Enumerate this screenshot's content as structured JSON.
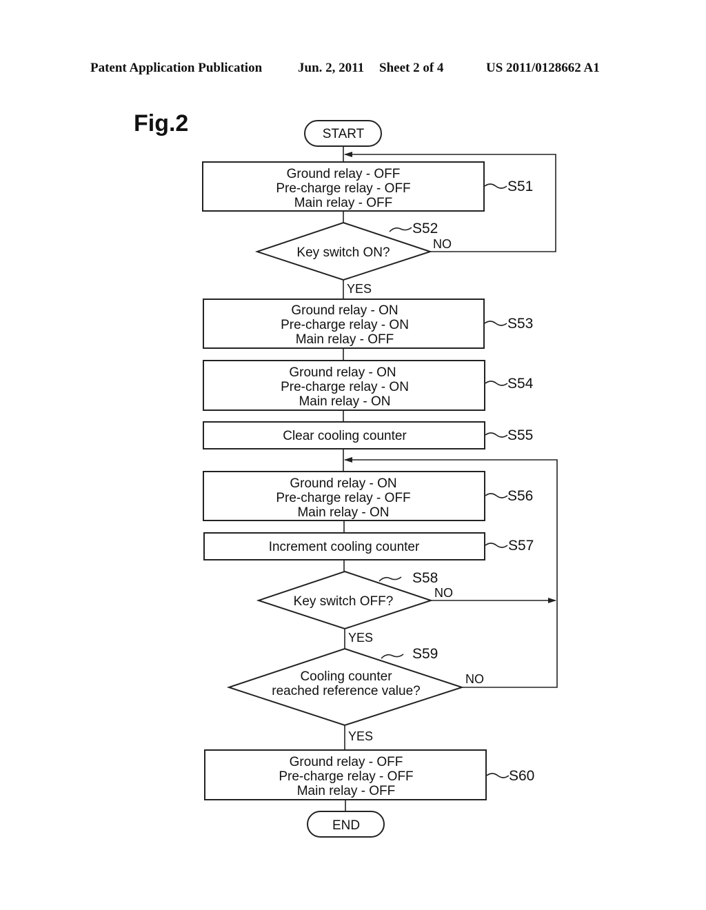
{
  "header": {
    "publication": "Patent Application Publication",
    "date": "Jun. 2, 2011",
    "sheet": "Sheet 2 of 4",
    "number": "US 2011/0128662 A1"
  },
  "figure": {
    "title": "Fig.2"
  },
  "flowchart": {
    "start": "START",
    "end": "END",
    "steps": [
      {
        "id": "S51",
        "type": "process",
        "lines": [
          "Ground relay - OFF",
          "Pre-charge relay - OFF",
          "Main relay - OFF"
        ]
      },
      {
        "id": "S52",
        "type": "decision",
        "lines": [
          "Key switch ON?"
        ],
        "yes": "YES",
        "no": "NO"
      },
      {
        "id": "S53",
        "type": "process",
        "lines": [
          "Ground relay - ON",
          "Pre-charge relay - ON",
          "Main relay - OFF"
        ]
      },
      {
        "id": "S54",
        "type": "process",
        "lines": [
          "Ground relay - ON",
          "Pre-charge relay - ON",
          "Main relay - ON"
        ]
      },
      {
        "id": "S55",
        "type": "process",
        "lines": [
          "Clear cooling counter"
        ]
      },
      {
        "id": "S56",
        "type": "process",
        "lines": [
          "Ground relay - ON",
          "Pre-charge relay - OFF",
          "Main relay - ON"
        ]
      },
      {
        "id": "S57",
        "type": "process",
        "lines": [
          "Increment cooling counter"
        ]
      },
      {
        "id": "S58",
        "type": "decision",
        "lines": [
          "Key switch OFF?"
        ],
        "yes": "YES",
        "no": "NO"
      },
      {
        "id": "S59",
        "type": "decision",
        "lines": [
          "Cooling counter",
          "reached reference value?"
        ],
        "yes": "YES",
        "no": "NO"
      },
      {
        "id": "S60",
        "type": "process",
        "lines": [
          "Ground relay - OFF",
          "Pre-charge relay - OFF",
          "Main relay - OFF"
        ]
      }
    ]
  }
}
